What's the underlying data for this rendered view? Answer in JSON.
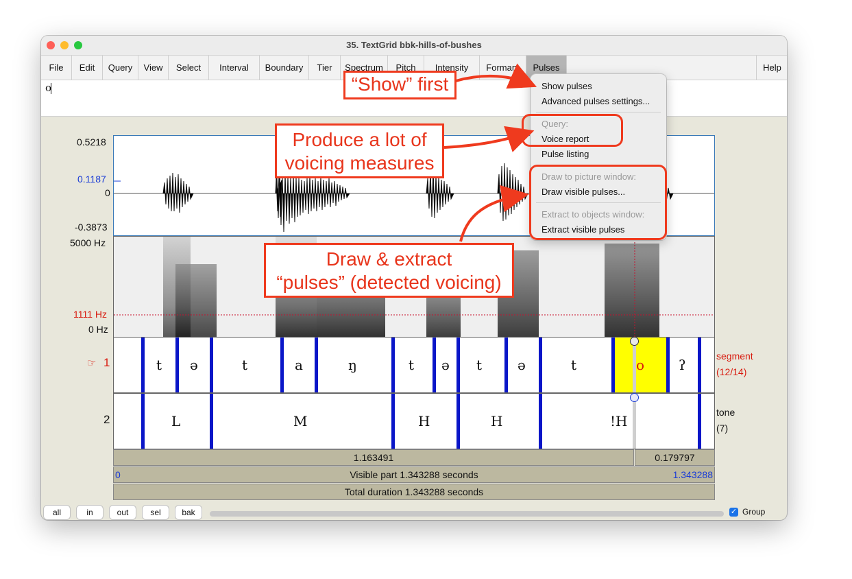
{
  "window": {
    "title": "35. TextGrid bbk-hills-of-bushes"
  },
  "menus": [
    "File",
    "Edit",
    "Query",
    "View",
    "Select",
    "Interval",
    "Boundary",
    "Tier",
    "Spectrum",
    "Pitch",
    "Intensity",
    "Formant",
    "Pulses"
  ],
  "help_label": "Help",
  "text_field_value": "o",
  "pulses_menu": {
    "show_pulses": "Show pulses",
    "advanced_settings": "Advanced pulses settings...",
    "query_header": "Query:",
    "voice_report": "Voice report",
    "pulse_listing": "Pulse listing",
    "draw_header": "Draw to picture window:",
    "draw_visible": "Draw visible pulses...",
    "extract_header": "Extract to objects window:",
    "extract_visible": "Extract visible pulses"
  },
  "waveform": {
    "max": "0.5218",
    "cursor_value": "0.1187",
    "zero": "0",
    "min": "-0.3873"
  },
  "spectrogram": {
    "max_freq": "5000 Hz",
    "cursor_freq": "1111 Hz",
    "min_freq": "0 Hz"
  },
  "tier1": {
    "label_number": "1",
    "pointer": "☞",
    "name": "segment",
    "count": "(12/14)",
    "segments": [
      "t",
      "ə",
      "t",
      "a",
      "ŋ",
      "t",
      "ə",
      "t",
      "ə",
      "t",
      "o",
      "ʔ"
    ]
  },
  "tier2": {
    "label_number": "2",
    "name": "tone",
    "count": "(7)",
    "segments": [
      "L",
      "M",
      "H",
      "H",
      "!H"
    ]
  },
  "time_bars": {
    "left_duration": "1.163491",
    "right_duration": "0.179797",
    "visible_start": "0",
    "visible_label": "Visible part 1.343288 seconds",
    "visible_end": "1.343288",
    "total_label": "Total duration 1.343288 seconds"
  },
  "bottom_buttons": [
    "all",
    "in",
    "out",
    "sel",
    "bak"
  ],
  "group": {
    "label": "Group",
    "checked": true
  },
  "annotations": {
    "show_first": "“Show” first",
    "voicing_line1": "Produce a lot of",
    "voicing_line2": "voicing measures",
    "draw_line1": "Draw & extract",
    "draw_line2": "“pulses” (detected voicing)"
  },
  "colors": {
    "accent_red": "#ef3a1e",
    "tier_boundary": "#0a16c8",
    "selection": "#ffff00",
    "cursor_blue": "#1a3cd6"
  }
}
